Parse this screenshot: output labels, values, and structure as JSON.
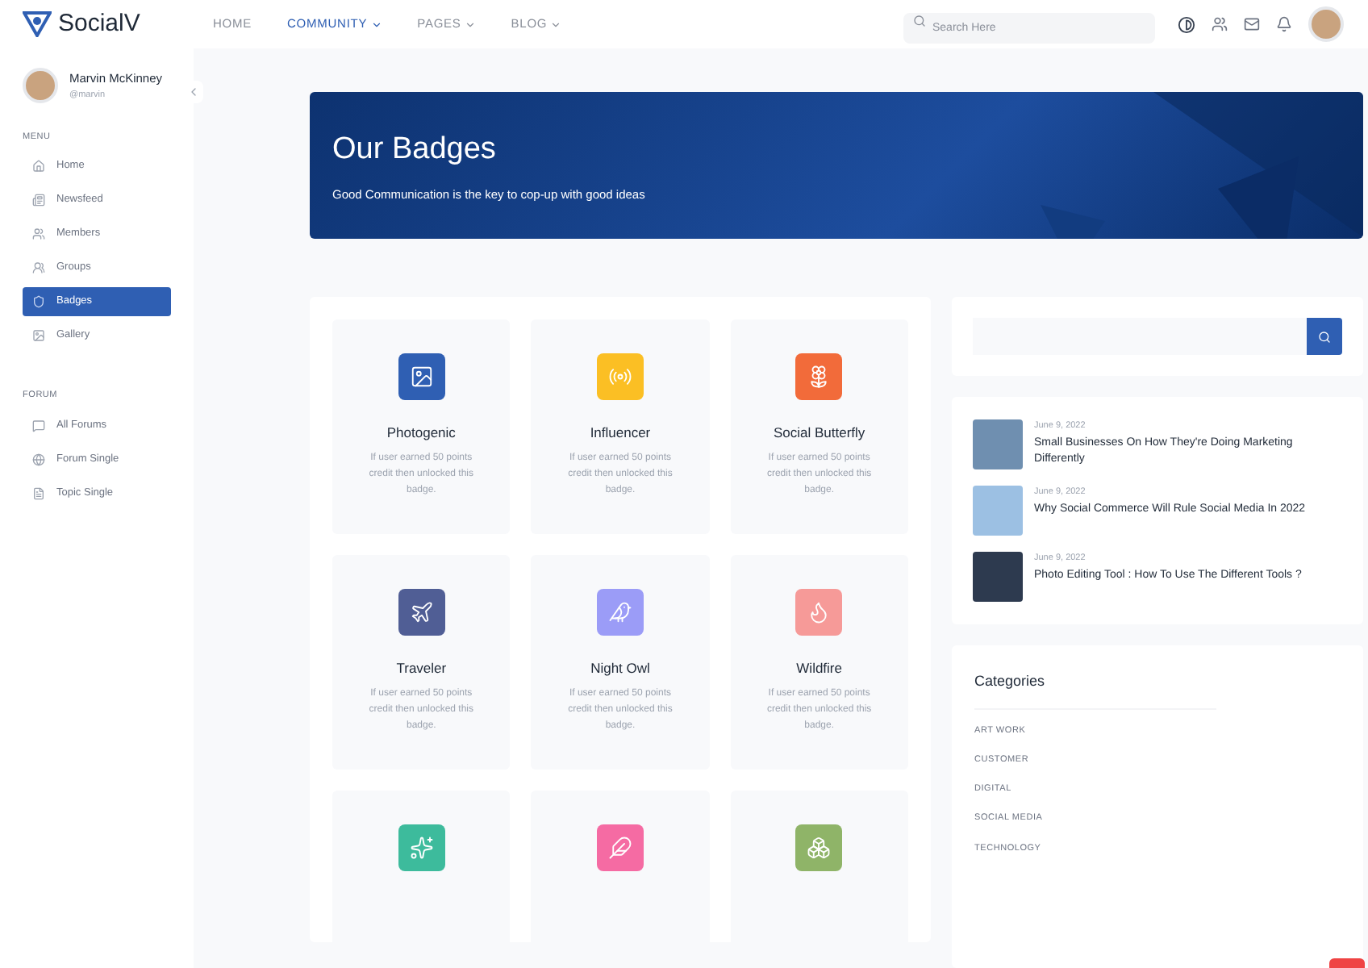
{
  "header": {
    "logo": "SocialV",
    "nav": [
      {
        "label": "HOME",
        "selected": false,
        "dropdown": false
      },
      {
        "label": "COMMUNITY",
        "selected": true,
        "dropdown": true
      },
      {
        "label": "PAGES",
        "selected": false,
        "dropdown": true
      },
      {
        "label": "BLOG",
        "selected": false,
        "dropdown": true
      }
    ],
    "search": {
      "placeholder": "Search Here"
    }
  },
  "sidebar": {
    "user": {
      "name": "Marvin McKinney",
      "handle": "@marvin"
    },
    "sections": [
      {
        "title": "MENU",
        "items": [
          {
            "label": "Home",
            "selected": false
          },
          {
            "label": "Newsfeed",
            "selected": false
          },
          {
            "label": "Members",
            "selected": false
          },
          {
            "label": "Groups",
            "selected": false
          },
          {
            "label": "Badges",
            "selected": true
          },
          {
            "label": "Gallery",
            "selected": false
          }
        ]
      },
      {
        "title": "FORUM",
        "items": [
          {
            "label": "All Forums",
            "selected": false
          },
          {
            "label": "Forum Single",
            "selected": false
          },
          {
            "label": "Topic Single",
            "selected": false
          }
        ]
      }
    ]
  },
  "banner": {
    "title": "Our Badges",
    "subtitle": "Good Communication is the key to cop-up with good ideas"
  },
  "badges": [
    {
      "name": "Photogenic",
      "description": "If user earned 50 points credit then unlocked this badge.",
      "color": "#2f5fb3"
    },
    {
      "name": "Influencer",
      "description": "If user earned 50 points credit then unlocked this badge.",
      "color": "#fbbf24"
    },
    {
      "name": "Social Butterfly",
      "description": "If user earned 50 points credit then unlocked this badge.",
      "color": "#f26b3a"
    },
    {
      "name": "Traveler",
      "description": "If user earned 50 points credit then unlocked this badge.",
      "color": "#505e95"
    },
    {
      "name": "Night Owl",
      "description": "If user earned 50 points credit then unlocked this badge.",
      "color": "#9b9cf7"
    },
    {
      "name": "Wildfire",
      "description": "If user earned 50 points credit then unlocked this badge.",
      "color": "#f69a98"
    },
    {
      "color": "#3dbb9c"
    },
    {
      "color": "#f56ba3"
    },
    {
      "color": "#8fb468"
    }
  ],
  "posts": [
    {
      "date": "June 9, 2022",
      "title": "Small Businesses On How They're Doing Marketing Differently"
    },
    {
      "date": "June 9, 2022",
      "title": "Why Social Commerce Will Rule Social Media In 2022"
    },
    {
      "date": "June 9, 2022",
      "title": "Photo Editing Tool : How To Use The Different Tools ?"
    }
  ],
  "categories": {
    "title": "Categories",
    "items": [
      "ART WORK",
      "CUSTOMER",
      "DIGITAL",
      "SOCIAL MEDIA",
      "TECHNOLOGY"
    ]
  }
}
